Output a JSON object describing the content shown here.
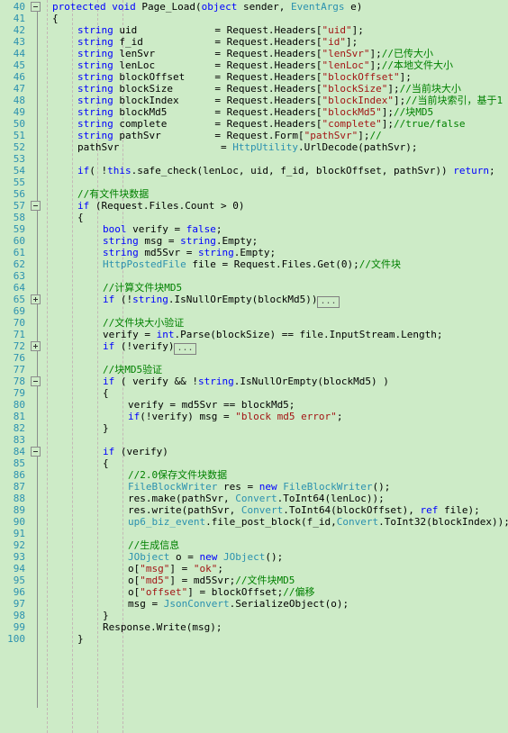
{
  "editor": {
    "app": "code-editor",
    "language": "csharp",
    "background_color": "#cdebc7",
    "line_number_color": "#2b91af",
    "keyword_color": "#0000ff",
    "type_color": "#2b91af",
    "string_color": "#a31515",
    "comment_color": "#008000",
    "indent_guide_color": "#c3aeb4",
    "fold_rail_color": "#8c8c8c",
    "first_line_number": 40,
    "last_line_number": 100,
    "collapsed_marker": "..."
  },
  "lines": [
    {
      "num": "40",
      "indent": 0,
      "fold": "minus",
      "tokens": [
        {
          "t": "kw",
          "s": "protected "
        },
        {
          "t": "kw",
          "s": "void"
        },
        {
          "t": "pln",
          "s": " Page_Load("
        },
        {
          "t": "kw",
          "s": "object"
        },
        {
          "t": "pln",
          "s": " sender, "
        },
        {
          "t": "typ",
          "s": "EventArgs"
        },
        {
          "t": "pln",
          "s": " e)"
        }
      ]
    },
    {
      "num": "41",
      "indent": 0,
      "fold": "",
      "tokens": [
        {
          "t": "pln",
          "s": "{"
        }
      ]
    },
    {
      "num": "42",
      "indent": 1,
      "fold": "",
      "tokens": [
        {
          "t": "kw",
          "s": "string"
        },
        {
          "t": "pln",
          "s": " uid             = Request.Headers["
        },
        {
          "t": "str",
          "s": "\"uid\""
        },
        {
          "t": "pln",
          "s": "];"
        }
      ]
    },
    {
      "num": "43",
      "indent": 1,
      "fold": "",
      "tokens": [
        {
          "t": "kw",
          "s": "string"
        },
        {
          "t": "pln",
          "s": " f_id            = Request.Headers["
        },
        {
          "t": "str",
          "s": "\"id\""
        },
        {
          "t": "pln",
          "s": "];"
        }
      ]
    },
    {
      "num": "44",
      "indent": 1,
      "fold": "",
      "tokens": [
        {
          "t": "kw",
          "s": "string"
        },
        {
          "t": "pln",
          "s": " lenSvr          = Request.Headers["
        },
        {
          "t": "str",
          "s": "\"lenSvr\""
        },
        {
          "t": "pln",
          "s": "];"
        },
        {
          "t": "cmt",
          "s": "//已传大小"
        }
      ]
    },
    {
      "num": "45",
      "indent": 1,
      "fold": "",
      "tokens": [
        {
          "t": "kw",
          "s": "string"
        },
        {
          "t": "pln",
          "s": " lenLoc          = Request.Headers["
        },
        {
          "t": "str",
          "s": "\"lenLoc\""
        },
        {
          "t": "pln",
          "s": "];"
        },
        {
          "t": "cmt",
          "s": "//本地文件大小"
        }
      ]
    },
    {
      "num": "46",
      "indent": 1,
      "fold": "",
      "tokens": [
        {
          "t": "kw",
          "s": "string"
        },
        {
          "t": "pln",
          "s": " blockOffset     = Request.Headers["
        },
        {
          "t": "str",
          "s": "\"blockOffset\""
        },
        {
          "t": "pln",
          "s": "];"
        }
      ]
    },
    {
      "num": "47",
      "indent": 1,
      "fold": "",
      "tokens": [
        {
          "t": "kw",
          "s": "string"
        },
        {
          "t": "pln",
          "s": " blockSize       = Request.Headers["
        },
        {
          "t": "str",
          "s": "\"blockSize\""
        },
        {
          "t": "pln",
          "s": "];"
        },
        {
          "t": "cmt",
          "s": "//当前块大小"
        }
      ]
    },
    {
      "num": "48",
      "indent": 1,
      "fold": "",
      "tokens": [
        {
          "t": "kw",
          "s": "string"
        },
        {
          "t": "pln",
          "s": " blockIndex      = Request.Headers["
        },
        {
          "t": "str",
          "s": "\"blockIndex\""
        },
        {
          "t": "pln",
          "s": "];"
        },
        {
          "t": "cmt",
          "s": "//当前块索引，基于1"
        }
      ]
    },
    {
      "num": "49",
      "indent": 1,
      "fold": "",
      "tokens": [
        {
          "t": "kw",
          "s": "string"
        },
        {
          "t": "pln",
          "s": " blockMd5        = Request.Headers["
        },
        {
          "t": "str",
          "s": "\"blockMd5\""
        },
        {
          "t": "pln",
          "s": "];"
        },
        {
          "t": "cmt",
          "s": "//块MD5"
        }
      ]
    },
    {
      "num": "50",
      "indent": 1,
      "fold": "",
      "tokens": [
        {
          "t": "kw",
          "s": "string"
        },
        {
          "t": "pln",
          "s": " complete        = Request.Headers["
        },
        {
          "t": "str",
          "s": "\"complete\""
        },
        {
          "t": "pln",
          "s": "];"
        },
        {
          "t": "cmt",
          "s": "//true/false"
        }
      ]
    },
    {
      "num": "51",
      "indent": 1,
      "fold": "",
      "tokens": [
        {
          "t": "kw",
          "s": "string"
        },
        {
          "t": "pln",
          "s": " pathSvr         = Request.Form["
        },
        {
          "t": "str",
          "s": "\"pathSvr\""
        },
        {
          "t": "pln",
          "s": "];"
        },
        {
          "t": "cmt",
          "s": "//"
        }
      ]
    },
    {
      "num": "52",
      "indent": 1,
      "fold": "",
      "tokens": [
        {
          "t": "pln",
          "s": "pathSvr                 = "
        },
        {
          "t": "typ",
          "s": "HttpUtility"
        },
        {
          "t": "pln",
          "s": ".UrlDecode(pathSvr);"
        }
      ]
    },
    {
      "num": "53",
      "indent": 1,
      "fold": "",
      "tokens": []
    },
    {
      "num": "54",
      "indent": 1,
      "fold": "",
      "tokens": [
        {
          "t": "kw",
          "s": "if"
        },
        {
          "t": "pln",
          "s": "( !"
        },
        {
          "t": "kw",
          "s": "this"
        },
        {
          "t": "pln",
          "s": ".safe_check(lenLoc, uid, f_id, blockOffset, pathSvr)) "
        },
        {
          "t": "kw",
          "s": "return"
        },
        {
          "t": "pln",
          "s": ";"
        }
      ]
    },
    {
      "num": "55",
      "indent": 1,
      "fold": "",
      "tokens": []
    },
    {
      "num": "56",
      "indent": 1,
      "fold": "",
      "tokens": [
        {
          "t": "cmt",
          "s": "//有文件块数据"
        }
      ]
    },
    {
      "num": "57",
      "indent": 1,
      "fold": "minus",
      "tokens": [
        {
          "t": "kw",
          "s": "if"
        },
        {
          "t": "pln",
          "s": " (Request.Files.Count > 0)"
        }
      ]
    },
    {
      "num": "58",
      "indent": 1,
      "fold": "",
      "tokens": [
        {
          "t": "pln",
          "s": "{"
        }
      ]
    },
    {
      "num": "59",
      "indent": 2,
      "fold": "",
      "tokens": [
        {
          "t": "kw",
          "s": "bool"
        },
        {
          "t": "pln",
          "s": " verify = "
        },
        {
          "t": "kw",
          "s": "false"
        },
        {
          "t": "pln",
          "s": ";"
        }
      ]
    },
    {
      "num": "60",
      "indent": 2,
      "fold": "",
      "tokens": [
        {
          "t": "kw",
          "s": "string"
        },
        {
          "t": "pln",
          "s": " msg = "
        },
        {
          "t": "kw",
          "s": "string"
        },
        {
          "t": "pln",
          "s": ".Empty;"
        }
      ]
    },
    {
      "num": "61",
      "indent": 2,
      "fold": "",
      "tokens": [
        {
          "t": "kw",
          "s": "string"
        },
        {
          "t": "pln",
          "s": " md5Svr = "
        },
        {
          "t": "kw",
          "s": "string"
        },
        {
          "t": "pln",
          "s": ".Empty;"
        }
      ]
    },
    {
      "num": "62",
      "indent": 2,
      "fold": "",
      "tokens": [
        {
          "t": "typ",
          "s": "HttpPostedFile"
        },
        {
          "t": "pln",
          "s": " file = Request.Files.Get(0);"
        },
        {
          "t": "cmt",
          "s": "//文件块"
        }
      ]
    },
    {
      "num": "63",
      "indent": 2,
      "fold": "",
      "tokens": []
    },
    {
      "num": "64",
      "indent": 2,
      "fold": "",
      "tokens": [
        {
          "t": "cmt",
          "s": "//计算文件块MD5"
        }
      ]
    },
    {
      "num": "65",
      "indent": 2,
      "fold": "plus",
      "collapsed": true,
      "tokens": [
        {
          "t": "kw",
          "s": "if"
        },
        {
          "t": "pln",
          "s": " (!"
        },
        {
          "t": "kw",
          "s": "string"
        },
        {
          "t": "pln",
          "s": ".IsNullOrEmpty(blockMd5))"
        }
      ]
    },
    {
      "num": "69",
      "indent": 2,
      "fold": "",
      "tokens": []
    },
    {
      "num": "70",
      "indent": 2,
      "fold": "",
      "tokens": [
        {
          "t": "cmt",
          "s": "//文件块大小验证"
        }
      ]
    },
    {
      "num": "71",
      "indent": 2,
      "fold": "",
      "tokens": [
        {
          "t": "pln",
          "s": "verify = "
        },
        {
          "t": "kw",
          "s": "int"
        },
        {
          "t": "pln",
          "s": ".Parse(blockSize) == file.InputStream.Length;"
        }
      ]
    },
    {
      "num": "72",
      "indent": 2,
      "fold": "plus",
      "collapsed": true,
      "tokens": [
        {
          "t": "kw",
          "s": "if"
        },
        {
          "t": "pln",
          "s": " (!verify)"
        }
      ]
    },
    {
      "num": "76",
      "indent": 2,
      "fold": "",
      "tokens": []
    },
    {
      "num": "77",
      "indent": 2,
      "fold": "",
      "tokens": [
        {
          "t": "cmt",
          "s": "//块MD5验证"
        }
      ]
    },
    {
      "num": "78",
      "indent": 2,
      "fold": "minus",
      "tokens": [
        {
          "t": "kw",
          "s": "if"
        },
        {
          "t": "pln",
          "s": " ( verify && !"
        },
        {
          "t": "kw",
          "s": "string"
        },
        {
          "t": "pln",
          "s": ".IsNullOrEmpty(blockMd5) )"
        }
      ]
    },
    {
      "num": "79",
      "indent": 2,
      "fold": "",
      "tokens": [
        {
          "t": "pln",
          "s": "{"
        }
      ]
    },
    {
      "num": "80",
      "indent": 3,
      "fold": "",
      "tokens": [
        {
          "t": "pln",
          "s": "verify = md5Svr == blockMd5;"
        }
      ]
    },
    {
      "num": "81",
      "indent": 3,
      "fold": "",
      "tokens": [
        {
          "t": "kw",
          "s": "if"
        },
        {
          "t": "pln",
          "s": "(!verify) msg = "
        },
        {
          "t": "str",
          "s": "\"block md5 error\""
        },
        {
          "t": "pln",
          "s": ";"
        }
      ]
    },
    {
      "num": "82",
      "indent": 2,
      "fold": "",
      "tokens": [
        {
          "t": "pln",
          "s": "}"
        }
      ]
    },
    {
      "num": "83",
      "indent": 2,
      "fold": "",
      "tokens": []
    },
    {
      "num": "84",
      "indent": 2,
      "fold": "minus",
      "tokens": [
        {
          "t": "kw",
          "s": "if"
        },
        {
          "t": "pln",
          "s": " (verify)"
        }
      ]
    },
    {
      "num": "85",
      "indent": 2,
      "fold": "",
      "tokens": [
        {
          "t": "pln",
          "s": "{"
        }
      ]
    },
    {
      "num": "86",
      "indent": 3,
      "fold": "",
      "tokens": [
        {
          "t": "cmt",
          "s": "//2.0保存文件块数据"
        }
      ]
    },
    {
      "num": "87",
      "indent": 3,
      "fold": "",
      "tokens": [
        {
          "t": "typ",
          "s": "FileBlockWriter"
        },
        {
          "t": "pln",
          "s": " res = "
        },
        {
          "t": "kw",
          "s": "new"
        },
        {
          "t": "pln",
          "s": " "
        },
        {
          "t": "typ",
          "s": "FileBlockWriter"
        },
        {
          "t": "pln",
          "s": "();"
        }
      ]
    },
    {
      "num": "88",
      "indent": 3,
      "fold": "",
      "tokens": [
        {
          "t": "pln",
          "s": "res.make(pathSvr, "
        },
        {
          "t": "typ",
          "s": "Convert"
        },
        {
          "t": "pln",
          "s": ".ToInt64(lenLoc));"
        }
      ]
    },
    {
      "num": "89",
      "indent": 3,
      "fold": "",
      "tokens": [
        {
          "t": "pln",
          "s": "res.write(pathSvr, "
        },
        {
          "t": "typ",
          "s": "Convert"
        },
        {
          "t": "pln",
          "s": ".ToInt64(blockOffset), "
        },
        {
          "t": "kw",
          "s": "ref"
        },
        {
          "t": "pln",
          "s": " file);"
        }
      ]
    },
    {
      "num": "90",
      "indent": 3,
      "fold": "",
      "tokens": [
        {
          "t": "typ",
          "s": "up6_biz_event"
        },
        {
          "t": "pln",
          "s": ".file_post_block(f_id,"
        },
        {
          "t": "typ",
          "s": "Convert"
        },
        {
          "t": "pln",
          "s": ".ToInt32(blockIndex));"
        }
      ]
    },
    {
      "num": "91",
      "indent": 3,
      "fold": "",
      "tokens": []
    },
    {
      "num": "92",
      "indent": 3,
      "fold": "",
      "tokens": [
        {
          "t": "cmt",
          "s": "//生成信息"
        }
      ]
    },
    {
      "num": "93",
      "indent": 3,
      "fold": "",
      "tokens": [
        {
          "t": "typ",
          "s": "JObject"
        },
        {
          "t": "pln",
          "s": " o = "
        },
        {
          "t": "kw",
          "s": "new"
        },
        {
          "t": "pln",
          "s": " "
        },
        {
          "t": "typ",
          "s": "JObject"
        },
        {
          "t": "pln",
          "s": "();"
        }
      ]
    },
    {
      "num": "94",
      "indent": 3,
      "fold": "",
      "tokens": [
        {
          "t": "pln",
          "s": "o["
        },
        {
          "t": "str",
          "s": "\"msg\""
        },
        {
          "t": "pln",
          "s": "] = "
        },
        {
          "t": "str",
          "s": "\"ok\""
        },
        {
          "t": "pln",
          "s": ";"
        }
      ]
    },
    {
      "num": "95",
      "indent": 3,
      "fold": "",
      "tokens": [
        {
          "t": "pln",
          "s": "o["
        },
        {
          "t": "str",
          "s": "\"md5\""
        },
        {
          "t": "pln",
          "s": "] = md5Svr;"
        },
        {
          "t": "cmt",
          "s": "//文件块MD5"
        }
      ]
    },
    {
      "num": "96",
      "indent": 3,
      "fold": "",
      "tokens": [
        {
          "t": "pln",
          "s": "o["
        },
        {
          "t": "str",
          "s": "\"offset\""
        },
        {
          "t": "pln",
          "s": "] = blockOffset;"
        },
        {
          "t": "cmt",
          "s": "//偏移"
        }
      ]
    },
    {
      "num": "97",
      "indent": 3,
      "fold": "",
      "tokens": [
        {
          "t": "pln",
          "s": "msg = "
        },
        {
          "t": "typ",
          "s": "JsonConvert"
        },
        {
          "t": "pln",
          "s": ".SerializeObject(o);"
        }
      ]
    },
    {
      "num": "98",
      "indent": 2,
      "fold": "",
      "tokens": [
        {
          "t": "pln",
          "s": "}"
        }
      ]
    },
    {
      "num": "99",
      "indent": 2,
      "fold": "",
      "tokens": [
        {
          "t": "pln",
          "s": "Response.Write(msg);"
        }
      ]
    },
    {
      "num": "100",
      "indent": 1,
      "fold": "",
      "tokens": [
        {
          "t": "pln",
          "s": "}"
        }
      ]
    }
  ]
}
